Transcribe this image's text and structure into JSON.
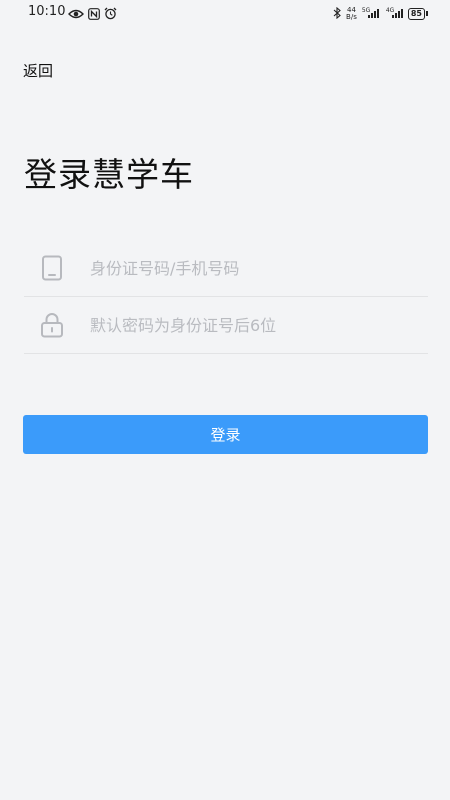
{
  "status_bar": {
    "time": "10:10",
    "net_speed_value": "44",
    "net_speed_unit": "B/s",
    "signal1_tag": "5G",
    "signal2_tag": "4G",
    "battery": "85",
    "icons": [
      "eye-icon",
      "nfc-icon",
      "alarm-icon",
      "bluetooth-icon",
      "signal-icon",
      "battery-icon"
    ]
  },
  "header": {
    "back_label": "返回"
  },
  "main": {
    "title": "登录慧学车",
    "phone_field": {
      "placeholder": "身份证号码/手机号码",
      "value": "",
      "icon": "phone-icon"
    },
    "password_field": {
      "placeholder": "默认密码为身份证号后6位",
      "value": "",
      "icon": "lock-icon"
    },
    "login_button_label": "登录"
  },
  "colors": {
    "background": "#f3f4f6",
    "accent": "#3b9bfa",
    "placeholder": "#b9bbc0",
    "divider": "#e2e3e5"
  }
}
